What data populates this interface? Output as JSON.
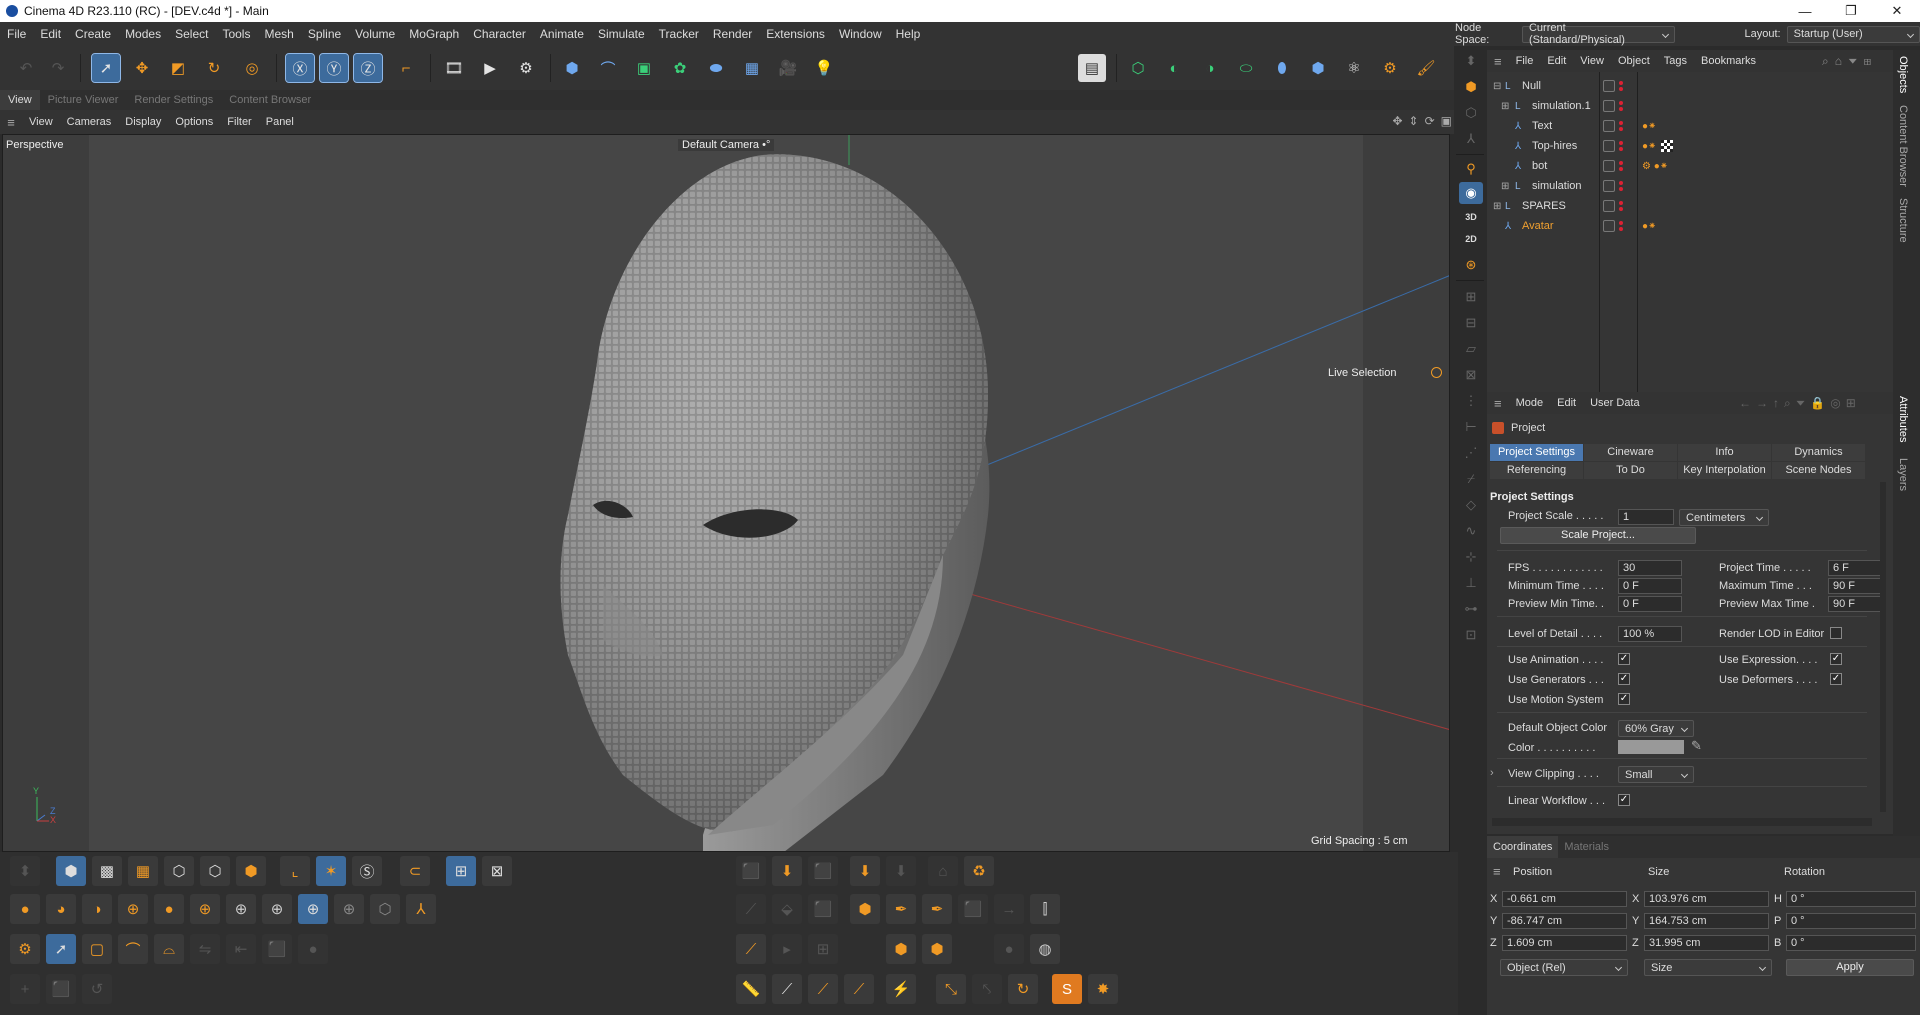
{
  "window": {
    "title": "Cinema 4D R23.110 (RC) - [DEV.c4d *] - Main",
    "minimize": "—",
    "maximize": "❐",
    "close": "✕"
  },
  "menu": [
    "File",
    "Edit",
    "Create",
    "Modes",
    "Select",
    "Tools",
    "Mesh",
    "Spline",
    "Volume",
    "MoGraph",
    "Character",
    "Animate",
    "Simulate",
    "Tracker",
    "Render",
    "Extensions",
    "Window",
    "Help"
  ],
  "node_space": {
    "label": "Node Space:",
    "value": "Current (Standard/Physical)"
  },
  "layout": {
    "label": "Layout:",
    "value": "Startup (User)"
  },
  "view_tabs": [
    "View",
    "Picture Viewer",
    "Render Settings",
    "Content Browser"
  ],
  "viewport_menu": [
    "View",
    "Cameras",
    "Display",
    "Options",
    "Filter",
    "Panel"
  ],
  "viewport": {
    "name": "Perspective",
    "camera": "Default Camera",
    "camera_suffix": "•°",
    "live_selection": "Live Selection",
    "grid_spacing": "Grid Spacing : 5 cm",
    "axis_y": "Y",
    "axis_z": "Z",
    "axis_x": "X"
  },
  "right_strip_labels": [
    "3D",
    "2D"
  ],
  "object_manager": {
    "menu": [
      "File",
      "Edit",
      "View",
      "Object",
      "Tags",
      "Bookmarks"
    ],
    "objects": [
      {
        "name": "Null"
      },
      {
        "name": "simulation.1"
      },
      {
        "name": "Text"
      },
      {
        "name": "Top-hires"
      },
      {
        "name": "bot"
      },
      {
        "name": "simulation"
      },
      {
        "name": "SPARES"
      },
      {
        "name": "Avatar"
      }
    ]
  },
  "side_tabs": [
    "Objects",
    "Content Browser",
    "Structure",
    "Attributes",
    "Layers"
  ],
  "attributes": {
    "menu": [
      "Mode",
      "Edit",
      "User Data"
    ],
    "object": "Project",
    "tabs_row1": [
      "Project Settings",
      "Cineware",
      "Info",
      "Dynamics"
    ],
    "tabs_row2": [
      "Referencing",
      "To Do",
      "Key Interpolation",
      "Scene Nodes"
    ],
    "section": "Project Settings",
    "project_scale_label": "Project Scale . . . . .",
    "project_scale_value": "1",
    "project_scale_unit": "Centimeters",
    "scale_button": "Scale Project...",
    "fps_label": "FPS . . . . . . . . . . . .",
    "fps_value": "30",
    "project_time_label": "Project Time . . . . .",
    "project_time_value": "6 F",
    "min_time_label": "Minimum Time . . . .",
    "min_time_value": "0 F",
    "max_time_label": "Maximum Time . . .",
    "max_time_value": "90 F",
    "preview_min_label": "Preview Min Time. .",
    "preview_min_value": "0 F",
    "preview_max_label": "Preview Max Time .",
    "preview_max_value": "90 F",
    "lod_label": "Level of Detail . . . .",
    "lod_value": "100 %",
    "render_lod_label": "Render LOD in Editor",
    "use_animation": "Use Animation . . . .",
    "use_expression": "Use Expression. . . .",
    "use_generators": "Use Generators . . .",
    "use_deformers": "Use Deformers . . . .",
    "use_motion": "Use Motion System",
    "default_color_label": "Default Object Color",
    "default_color_value": "60% Gray",
    "color_label": "Color . . . . . . . . . .",
    "view_clipping_label": "View Clipping . . . .",
    "view_clipping_value": "Small",
    "linear_workflow": "Linear Workflow . . .",
    "check": "✓"
  },
  "coordinates": {
    "tabs": [
      "Coordinates",
      "Materials"
    ],
    "headers": [
      "Position",
      "Size",
      "Rotation"
    ],
    "rows": [
      {
        "a": "X",
        "pos": "-0.661 cm",
        "b": "X",
        "size": "103.976 cm",
        "c": "H",
        "rot": "0 °"
      },
      {
        "a": "Y",
        "pos": "-86.747 cm",
        "b": "Y",
        "size": "164.753 cm",
        "c": "P",
        "rot": "0 °"
      },
      {
        "a": "Z",
        "pos": "1.609 cm",
        "b": "Z",
        "size": "31.995 cm",
        "c": "B",
        "rot": "0 °"
      }
    ],
    "mode": "Object (Rel)",
    "size_mode": "Size",
    "apply": "Apply"
  },
  "colors": {
    "accent": "#4a78b0",
    "orange": "#f09a25",
    "bg": "#353535"
  }
}
